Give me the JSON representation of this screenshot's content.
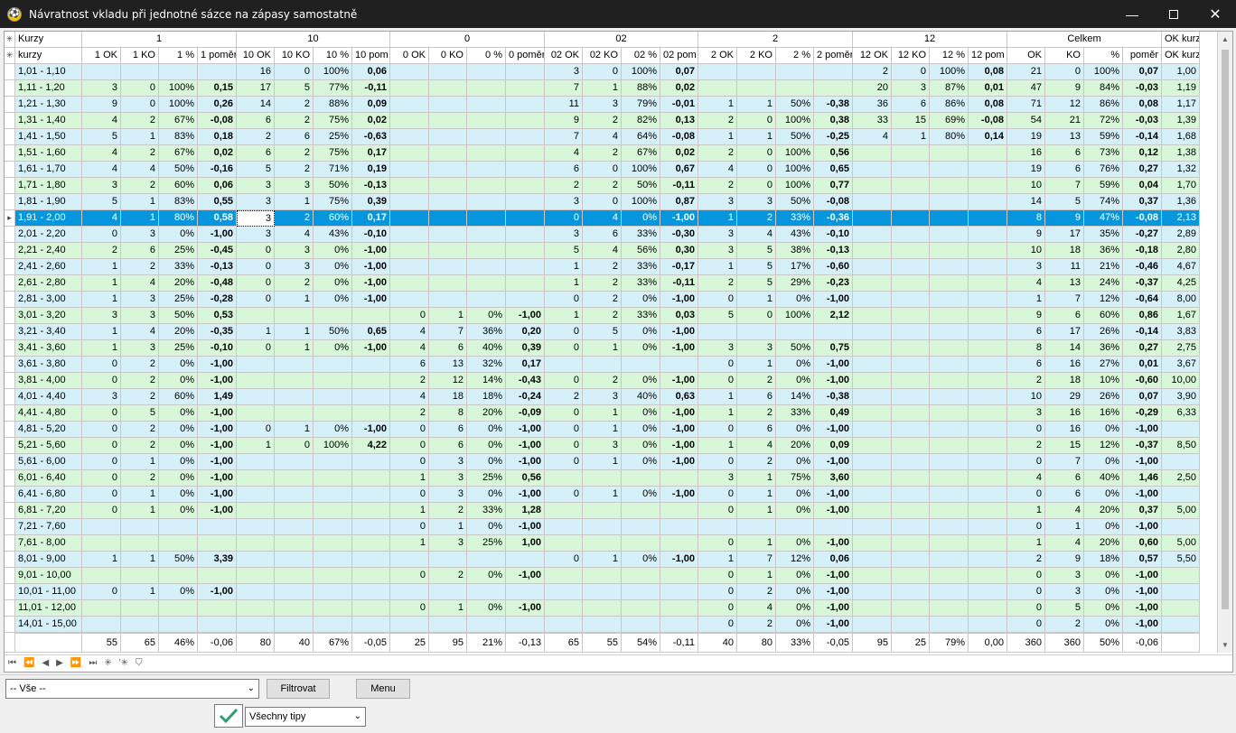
{
  "window": {
    "title": "Návratnost vkladu při jednotné sázce na zápasy samostatně",
    "icon_letter": "⚽"
  },
  "groups": [
    "Kurzy",
    "1",
    "10",
    "0",
    "02",
    "2",
    "12",
    "Celkem",
    "OK kurz"
  ],
  "columns": [
    "kurzy",
    "1 OK",
    "1 KO",
    "1 %",
    "1 poměr",
    "10 OK",
    "10 KO",
    "10 %",
    "10 pom",
    "0 OK",
    "0 KO",
    "0 %",
    "0 poměr",
    "02 OK",
    "02 KO",
    "02 %",
    "02 pom",
    "2 OK",
    "2 KO",
    "2 %",
    "2 poměr",
    "12 OK",
    "12 KO",
    "12 %",
    "12 pom",
    "OK",
    "KO",
    "%",
    "poměr",
    "OK kurz"
  ],
  "rows": [
    [
      "1,01 - 1,10",
      "",
      "",
      "",
      "",
      "16",
      "0",
      "100%",
      "0,06",
      "",
      "",
      "",
      "",
      "3",
      "0",
      "100%",
      "0,07",
      "",
      "",
      "",
      "",
      "2",
      "0",
      "100%",
      "0,08",
      "21",
      "0",
      "100%",
      "0,07",
      "1,00"
    ],
    [
      "1,11 - 1,20",
      "3",
      "0",
      "100%",
      "0,15",
      "17",
      "5",
      "77%",
      "-0,11",
      "",
      "",
      "",
      "",
      "7",
      "1",
      "88%",
      "0,02",
      "",
      "",
      "",
      "",
      "20",
      "3",
      "87%",
      "0,01",
      "47",
      "9",
      "84%",
      "-0,03",
      "1,19"
    ],
    [
      "1,21 - 1,30",
      "9",
      "0",
      "100%",
      "0,26",
      "14",
      "2",
      "88%",
      "0,09",
      "",
      "",
      "",
      "",
      "11",
      "3",
      "79%",
      "-0,01",
      "1",
      "1",
      "50%",
      "-0,38",
      "36",
      "6",
      "86%",
      "0,08",
      "71",
      "12",
      "86%",
      "0,08",
      "1,17"
    ],
    [
      "1,31 - 1,40",
      "4",
      "2",
      "67%",
      "-0,08",
      "6",
      "2",
      "75%",
      "0,02",
      "",
      "",
      "",
      "",
      "9",
      "2",
      "82%",
      "0,13",
      "2",
      "0",
      "100%",
      "0,38",
      "33",
      "15",
      "69%",
      "-0,08",
      "54",
      "21",
      "72%",
      "-0,03",
      "1,39"
    ],
    [
      "1,41 - 1,50",
      "5",
      "1",
      "83%",
      "0,18",
      "2",
      "6",
      "25%",
      "-0,63",
      "",
      "",
      "",
      "",
      "7",
      "4",
      "64%",
      "-0,08",
      "1",
      "1",
      "50%",
      "-0,25",
      "4",
      "1",
      "80%",
      "0,14",
      "19",
      "13",
      "59%",
      "-0,14",
      "1,68"
    ],
    [
      "1,51 - 1,60",
      "4",
      "2",
      "67%",
      "0,02",
      "6",
      "2",
      "75%",
      "0,17",
      "",
      "",
      "",
      "",
      "4",
      "2",
      "67%",
      "0,02",
      "2",
      "0",
      "100%",
      "0,56",
      "",
      "",
      "",
      "",
      "16",
      "6",
      "73%",
      "0,12",
      "1,38"
    ],
    [
      "1,61 - 1,70",
      "4",
      "4",
      "50%",
      "-0,16",
      "5",
      "2",
      "71%",
      "0,19",
      "",
      "",
      "",
      "",
      "6",
      "0",
      "100%",
      "0,67",
      "4",
      "0",
      "100%",
      "0,65",
      "",
      "",
      "",
      "",
      "19",
      "6",
      "76%",
      "0,27",
      "1,32"
    ],
    [
      "1,71 - 1,80",
      "3",
      "2",
      "60%",
      "0,06",
      "3",
      "3",
      "50%",
      "-0,13",
      "",
      "",
      "",
      "",
      "2",
      "2",
      "50%",
      "-0,11",
      "2",
      "0",
      "100%",
      "0,77",
      "",
      "",
      "",
      "",
      "10",
      "7",
      "59%",
      "0,04",
      "1,70"
    ],
    [
      "1,81 - 1,90",
      "5",
      "1",
      "83%",
      "0,55",
      "3",
      "1",
      "75%",
      "0,39",
      "",
      "",
      "",
      "",
      "3",
      "0",
      "100%",
      "0,87",
      "3",
      "3",
      "50%",
      "-0,08",
      "",
      "",
      "",
      "",
      "14",
      "5",
      "74%",
      "0,37",
      "1,36"
    ],
    [
      "1,91 - 2,00",
      "4",
      "1",
      "80%",
      "0,58",
      "3",
      "2",
      "60%",
      "0,17",
      "",
      "",
      "",
      "",
      "0",
      "4",
      "0%",
      "-1,00",
      "1",
      "2",
      "33%",
      "-0,36",
      "",
      "",
      "",
      "",
      "8",
      "9",
      "47%",
      "-0,08",
      "2,13"
    ],
    [
      "2,01 - 2,20",
      "0",
      "3",
      "0%",
      "-1,00",
      "3",
      "4",
      "43%",
      "-0,10",
      "",
      "",
      "",
      "",
      "3",
      "6",
      "33%",
      "-0,30",
      "3",
      "4",
      "43%",
      "-0,10",
      "",
      "",
      "",
      "",
      "9",
      "17",
      "35%",
      "-0,27",
      "2,89"
    ],
    [
      "2,21 - 2,40",
      "2",
      "6",
      "25%",
      "-0,45",
      "0",
      "3",
      "0%",
      "-1,00",
      "",
      "",
      "",
      "",
      "5",
      "4",
      "56%",
      "0,30",
      "3",
      "5",
      "38%",
      "-0,13",
      "",
      "",
      "",
      "",
      "10",
      "18",
      "36%",
      "-0,18",
      "2,80"
    ],
    [
      "2,41 - 2,60",
      "1",
      "2",
      "33%",
      "-0,13",
      "0",
      "3",
      "0%",
      "-1,00",
      "",
      "",
      "",
      "",
      "1",
      "2",
      "33%",
      "-0,17",
      "1",
      "5",
      "17%",
      "-0,60",
      "",
      "",
      "",
      "",
      "3",
      "11",
      "21%",
      "-0,46",
      "4,67"
    ],
    [
      "2,61 - 2,80",
      "1",
      "4",
      "20%",
      "-0,48",
      "0",
      "2",
      "0%",
      "-1,00",
      "",
      "",
      "",
      "",
      "1",
      "2",
      "33%",
      "-0,11",
      "2",
      "5",
      "29%",
      "-0,23",
      "",
      "",
      "",
      "",
      "4",
      "13",
      "24%",
      "-0,37",
      "4,25"
    ],
    [
      "2,81 - 3,00",
      "1",
      "3",
      "25%",
      "-0,28",
      "0",
      "1",
      "0%",
      "-1,00",
      "",
      "",
      "",
      "",
      "0",
      "2",
      "0%",
      "-1,00",
      "0",
      "1",
      "0%",
      "-1,00",
      "",
      "",
      "",
      "",
      "1",
      "7",
      "12%",
      "-0,64",
      "8,00"
    ],
    [
      "3,01 - 3,20",
      "3",
      "3",
      "50%",
      "0,53",
      "",
      "",
      "",
      "",
      "0",
      "1",
      "0%",
      "-1,00",
      "1",
      "2",
      "33%",
      "0,03",
      "5",
      "0",
      "100%",
      "2,12",
      "",
      "",
      "",
      "",
      "9",
      "6",
      "60%",
      "0,86",
      "1,67"
    ],
    [
      "3,21 - 3,40",
      "1",
      "4",
      "20%",
      "-0,35",
      "1",
      "1",
      "50%",
      "0,65",
      "4",
      "7",
      "36%",
      "0,20",
      "0",
      "5",
      "0%",
      "-1,00",
      "",
      "",
      "",
      "",
      "",
      "",
      "",
      "",
      "6",
      "17",
      "26%",
      "-0,14",
      "3,83"
    ],
    [
      "3,41 - 3,60",
      "1",
      "3",
      "25%",
      "-0,10",
      "0",
      "1",
      "0%",
      "-1,00",
      "4",
      "6",
      "40%",
      "0,39",
      "0",
      "1",
      "0%",
      "-1,00",
      "3",
      "3",
      "50%",
      "0,75",
      "",
      "",
      "",
      "",
      "8",
      "14",
      "36%",
      "0,27",
      "2,75"
    ],
    [
      "3,61 - 3,80",
      "0",
      "2",
      "0%",
      "-1,00",
      "",
      "",
      "",
      "",
      "6",
      "13",
      "32%",
      "0,17",
      "",
      "",
      "",
      "",
      "0",
      "1",
      "0%",
      "-1,00",
      "",
      "",
      "",
      "",
      "6",
      "16",
      "27%",
      "0,01",
      "3,67"
    ],
    [
      "3,81 - 4,00",
      "0",
      "2",
      "0%",
      "-1,00",
      "",
      "",
      "",
      "",
      "2",
      "12",
      "14%",
      "-0,43",
      "0",
      "2",
      "0%",
      "-1,00",
      "0",
      "2",
      "0%",
      "-1,00",
      "",
      "",
      "",
      "",
      "2",
      "18",
      "10%",
      "-0,60",
      "10,00"
    ],
    [
      "4,01 - 4,40",
      "3",
      "2",
      "60%",
      "1,49",
      "",
      "",
      "",
      "",
      "4",
      "18",
      "18%",
      "-0,24",
      "2",
      "3",
      "40%",
      "0,63",
      "1",
      "6",
      "14%",
      "-0,38",
      "",
      "",
      "",
      "",
      "10",
      "29",
      "26%",
      "0,07",
      "3,90"
    ],
    [
      "4,41 - 4,80",
      "0",
      "5",
      "0%",
      "-1,00",
      "",
      "",
      "",
      "",
      "2",
      "8",
      "20%",
      "-0,09",
      "0",
      "1",
      "0%",
      "-1,00",
      "1",
      "2",
      "33%",
      "0,49",
      "",
      "",
      "",
      "",
      "3",
      "16",
      "16%",
      "-0,29",
      "6,33"
    ],
    [
      "4,81 - 5,20",
      "0",
      "2",
      "0%",
      "-1,00",
      "0",
      "1",
      "0%",
      "-1,00",
      "0",
      "6",
      "0%",
      "-1,00",
      "0",
      "1",
      "0%",
      "-1,00",
      "0",
      "6",
      "0%",
      "-1,00",
      "",
      "",
      "",
      "",
      "0",
      "16",
      "0%",
      "-1,00",
      ""
    ],
    [
      "5,21 - 5,60",
      "0",
      "2",
      "0%",
      "-1,00",
      "1",
      "0",
      "100%",
      "4,22",
      "0",
      "6",
      "0%",
      "-1,00",
      "0",
      "3",
      "0%",
      "-1,00",
      "1",
      "4",
      "20%",
      "0,09",
      "",
      "",
      "",
      "",
      "2",
      "15",
      "12%",
      "-0,37",
      "8,50"
    ],
    [
      "5,61 - 6,00",
      "0",
      "1",
      "0%",
      "-1,00",
      "",
      "",
      "",
      "",
      "0",
      "3",
      "0%",
      "-1,00",
      "0",
      "1",
      "0%",
      "-1,00",
      "0",
      "2",
      "0%",
      "-1,00",
      "",
      "",
      "",
      "",
      "0",
      "7",
      "0%",
      "-1,00",
      ""
    ],
    [
      "6,01 - 6,40",
      "0",
      "2",
      "0%",
      "-1,00",
      "",
      "",
      "",
      "",
      "1",
      "3",
      "25%",
      "0,56",
      "",
      "",
      "",
      "",
      "3",
      "1",
      "75%",
      "3,60",
      "",
      "",
      "",
      "",
      "4",
      "6",
      "40%",
      "1,46",
      "2,50"
    ],
    [
      "6,41 - 6,80",
      "0",
      "1",
      "0%",
      "-1,00",
      "",
      "",
      "",
      "",
      "0",
      "3",
      "0%",
      "-1,00",
      "0",
      "1",
      "0%",
      "-1,00",
      "0",
      "1",
      "0%",
      "-1,00",
      "",
      "",
      "",
      "",
      "0",
      "6",
      "0%",
      "-1,00",
      ""
    ],
    [
      "6,81 - 7,20",
      "0",
      "1",
      "0%",
      "-1,00",
      "",
      "",
      "",
      "",
      "1",
      "2",
      "33%",
      "1,28",
      "",
      "",
      "",
      "",
      "0",
      "1",
      "0%",
      "-1,00",
      "",
      "",
      "",
      "",
      "1",
      "4",
      "20%",
      "0,37",
      "5,00"
    ],
    [
      "7,21 - 7,60",
      "",
      "",
      "",
      "",
      "",
      "",
      "",
      "",
      "0",
      "1",
      "0%",
      "-1,00",
      "",
      "",
      "",
      "",
      "",
      "",
      "",
      "",
      "",
      "",
      "",
      "",
      "0",
      "1",
      "0%",
      "-1,00",
      ""
    ],
    [
      "7,61 - 8,00",
      "",
      "",
      "",
      "",
      "",
      "",
      "",
      "",
      "1",
      "3",
      "25%",
      "1,00",
      "",
      "",
      "",
      "",
      "0",
      "1",
      "0%",
      "-1,00",
      "",
      "",
      "",
      "",
      "1",
      "4",
      "20%",
      "0,60",
      "5,00"
    ],
    [
      "8,01 - 9,00",
      "1",
      "1",
      "50%",
      "3,39",
      "",
      "",
      "",
      "",
      "",
      "",
      "",
      "",
      "0",
      "1",
      "0%",
      "-1,00",
      "1",
      "7",
      "12%",
      "0,06",
      "",
      "",
      "",
      "",
      "2",
      "9",
      "18%",
      "0,57",
      "5,50"
    ],
    [
      "9,01 - 10,00",
      "",
      "",
      "",
      "",
      "",
      "",
      "",
      "",
      "0",
      "2",
      "0%",
      "-1,00",
      "",
      "",
      "",
      "",
      "0",
      "1",
      "0%",
      "-1,00",
      "",
      "",
      "",
      "",
      "0",
      "3",
      "0%",
      "-1,00",
      ""
    ],
    [
      "10,01 - 11,00",
      "0",
      "1",
      "0%",
      "-1,00",
      "",
      "",
      "",
      "",
      "",
      "",
      "",
      "",
      "",
      "",
      "",
      "",
      "0",
      "2",
      "0%",
      "-1,00",
      "",
      "",
      "",
      "",
      "0",
      "3",
      "0%",
      "-1,00",
      ""
    ],
    [
      "11,01 - 12,00",
      "",
      "",
      "",
      "",
      "",
      "",
      "",
      "",
      "0",
      "1",
      "0%",
      "-1,00",
      "",
      "",
      "",
      "",
      "0",
      "4",
      "0%",
      "-1,00",
      "",
      "",
      "",
      "",
      "0",
      "5",
      "0%",
      "-1,00",
      ""
    ],
    [
      "14,01 - 15,00",
      "",
      "",
      "",
      "",
      "",
      "",
      "",
      "",
      "",
      "",
      "",
      "",
      "",
      "",
      "",
      "",
      "0",
      "2",
      "0%",
      "-1,00",
      "",
      "",
      "",
      "",
      "0",
      "2",
      "0%",
      "-1,00",
      ""
    ]
  ],
  "bold_cols": [
    4,
    8,
    12,
    16,
    20,
    24,
    28
  ],
  "selected_row": 9,
  "totals": [
    "",
    "55",
    "65",
    "46%",
    "-0,06",
    "80",
    "40",
    "67%",
    "-0,05",
    "25",
    "95",
    "21%",
    "-0,13",
    "65",
    "55",
    "54%",
    "-0,11",
    "40",
    "80",
    "33%",
    "-0,05",
    "95",
    "25",
    "79%",
    "0,00",
    "360",
    "360",
    "50%",
    "-0,06",
    ""
  ],
  "nav_icons": [
    "⏮",
    "⏪",
    "◀",
    "▶",
    "⏩",
    "⏭",
    "✳",
    "'✳",
    "⛉"
  ],
  "filter": {
    "value": "-- Vše --",
    "filter_label": "Filtrovat",
    "menu_label": "Menu",
    "tips_value": "Všechny tipy"
  }
}
